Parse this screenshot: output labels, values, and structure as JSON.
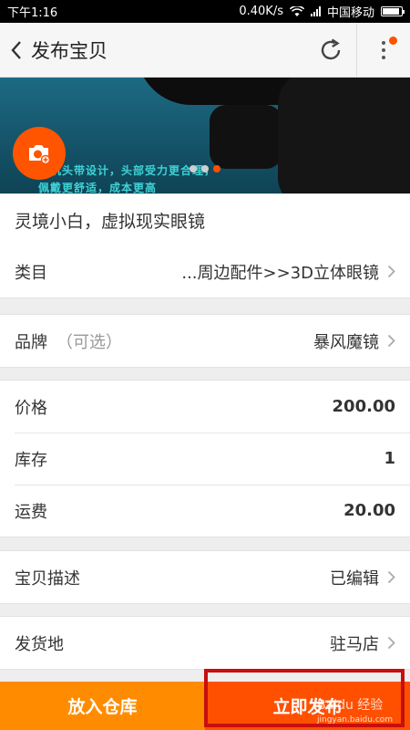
{
  "status": {
    "time": "下午1:16",
    "speed": "0.40K/s",
    "carrier": "中国移动"
  },
  "nav": {
    "title": "发布宝贝"
  },
  "banner": {
    "caption": "耳机头带设计，头部受力更合理，佩戴更舒适，成本更高"
  },
  "title_field": {
    "value": "灵境小白，虚拟现实眼镜"
  },
  "category": {
    "label": "类目",
    "value": "...周边配件>>3D立体眼镜"
  },
  "brand": {
    "label": "品牌",
    "optional": "（可选）",
    "value": "暴风魔镜"
  },
  "pricing": {
    "price_label": "价格",
    "price": "200.00",
    "stock_label": "库存",
    "stock": "1",
    "shipping_label": "运费",
    "shipping": "20.00"
  },
  "description": {
    "label": "宝贝描述",
    "value": "已编辑"
  },
  "origin": {
    "label": "发货地",
    "value": "驻马店"
  },
  "actions": {
    "warehouse": "放入仓库",
    "publish": "立即发布"
  },
  "watermark": {
    "brand": "Baidu 经验",
    "url": "jingyan.baidu.com"
  },
  "colors": {
    "accent": "#ff5000",
    "secondary": "#ff8c00",
    "highlight": "#c80e0e"
  }
}
